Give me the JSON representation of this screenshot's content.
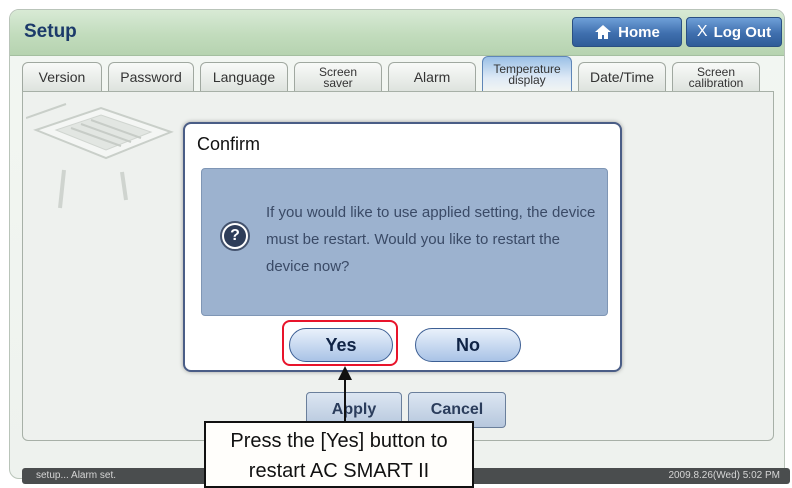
{
  "header": {
    "title": "Setup",
    "home_label": "Home",
    "logout_x": "X",
    "logout_label": "Log Out"
  },
  "tabs": [
    {
      "label": "Version"
    },
    {
      "label": "Password"
    },
    {
      "label": "Language"
    },
    {
      "line1": "Screen",
      "line2": "saver"
    },
    {
      "label": "Alarm"
    },
    {
      "line1": "Temperature",
      "line2": "display"
    },
    {
      "label": "Date/Time"
    },
    {
      "line1": "Screen",
      "line2": "calibration"
    }
  ],
  "active_tab": "Temperature display",
  "dialog": {
    "title": "Confirm",
    "icon": "question-icon",
    "icon_glyph": "?",
    "message": "If you would like to use applied setting, the device must be restart. Would you like to restart the device now?",
    "yes_label": "Yes",
    "no_label": "No"
  },
  "buttons": {
    "apply_label": "Apply",
    "cancel_label": "Cancel"
  },
  "status": {
    "left": "setup... Alarm set.",
    "right": "2009.8.26(Wed)  5:02 PM"
  },
  "annotation": {
    "line1": "Press the [Yes] button to",
    "line2": "restart AC SMART II",
    "highlight_color": "#e8142b"
  },
  "colors": {
    "accent": "#3f6fae",
    "header_green": "#c2dcbd",
    "dialog_panel": "#9cb2cf"
  }
}
